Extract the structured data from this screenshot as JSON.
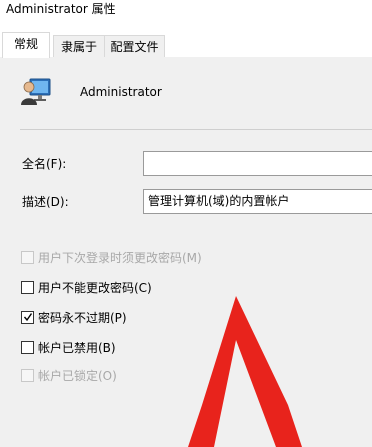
{
  "window": {
    "title": "Administrator 属性"
  },
  "tabs": [
    {
      "label": "常规",
      "active": true
    },
    {
      "label": "隶属于",
      "active": false
    },
    {
      "label": "配置文件",
      "active": false
    }
  ],
  "user": {
    "icon": "user-monitor-icon",
    "name": "Administrator"
  },
  "fields": {
    "fullname_label": "全名(F):",
    "fullname_value": "",
    "description_label": "描述(D):",
    "description_value": "管理计算机(域)的内置帐户"
  },
  "options": [
    {
      "label": "用户下次登录时须更改密码(M)",
      "checked": false,
      "enabled": false
    },
    {
      "label": "用户不能更改密码(C)",
      "checked": false,
      "enabled": true
    },
    {
      "label": "密码永不过期(P)",
      "checked": true,
      "enabled": true
    },
    {
      "label": "帐户已禁用(B)",
      "checked": false,
      "enabled": true
    },
    {
      "label": "帐户已锁定(O)",
      "checked": false,
      "enabled": false
    }
  ],
  "colors": {
    "annotation_arrow": "#e8231c",
    "panel_bg": "#f0f0f0",
    "disabled_text": "#a8a8a8"
  }
}
